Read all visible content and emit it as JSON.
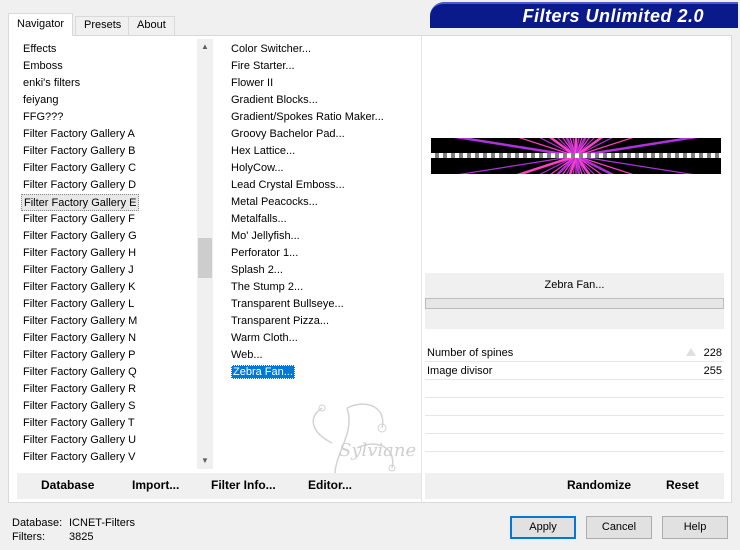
{
  "tabs": [
    "Navigator",
    "Presets",
    "About"
  ],
  "title": "Filters Unlimited 2.0",
  "categories": [
    "Effects",
    "Emboss",
    "enki's filters",
    "feiyang",
    "FFG???",
    "Filter Factory Gallery A",
    "Filter Factory Gallery B",
    "Filter Factory Gallery C",
    "Filter Factory Gallery D",
    "Filter Factory Gallery E",
    "Filter Factory Gallery F",
    "Filter Factory Gallery G",
    "Filter Factory Gallery H",
    "Filter Factory Gallery J",
    "Filter Factory Gallery K",
    "Filter Factory Gallery L",
    "Filter Factory Gallery M",
    "Filter Factory Gallery N",
    "Filter Factory Gallery P",
    "Filter Factory Gallery Q",
    "Filter Factory Gallery R",
    "Filter Factory Gallery S",
    "Filter Factory Gallery T",
    "Filter Factory Gallery U",
    "Filter Factory Gallery V"
  ],
  "selected_category": "Filter Factory Gallery E",
  "filters": [
    "Color Switcher...",
    "Fire Starter...",
    "Flower II",
    "Gradient Blocks...",
    "Gradient/Spokes Ratio Maker...",
    "Groovy Bachelor Pad...",
    "Hex Lattice...",
    "HolyCow...",
    "Lead Crystal Emboss...",
    "Metal Peacocks...",
    "Metalfalls...",
    "Mo' Jellyfish...",
    "Perforator 1...",
    "Splash 2...",
    "The Stump 2...",
    "Transparent Bullseye...",
    "Transparent Pizza...",
    "Warm Cloth...",
    "Web...",
    "Zebra Fan..."
  ],
  "selected_filter": "Zebra Fan...",
  "current_filter_name": "Zebra Fan...",
  "params": [
    {
      "label": "Number of spines",
      "value": "228"
    },
    {
      "label": "Image divisor",
      "value": "255"
    }
  ],
  "watermark": "Sylviane",
  "buttons": {
    "database": "Database",
    "import": "Import...",
    "filter_info": "Filter Info...",
    "editor": "Editor...",
    "randomize": "Randomize",
    "reset": "Reset",
    "apply": "Apply",
    "cancel": "Cancel",
    "help": "Help"
  },
  "status": {
    "database_label": "Database:",
    "database_value": "ICNET-Filters",
    "filters_label": "Filters:",
    "filters_value": "3825"
  },
  "colors": {
    "title_bg": "#0a1a8a",
    "selection": "#0078d7",
    "preview_purple": "#b030e0",
    "preview_pink": "#ff40c0"
  }
}
